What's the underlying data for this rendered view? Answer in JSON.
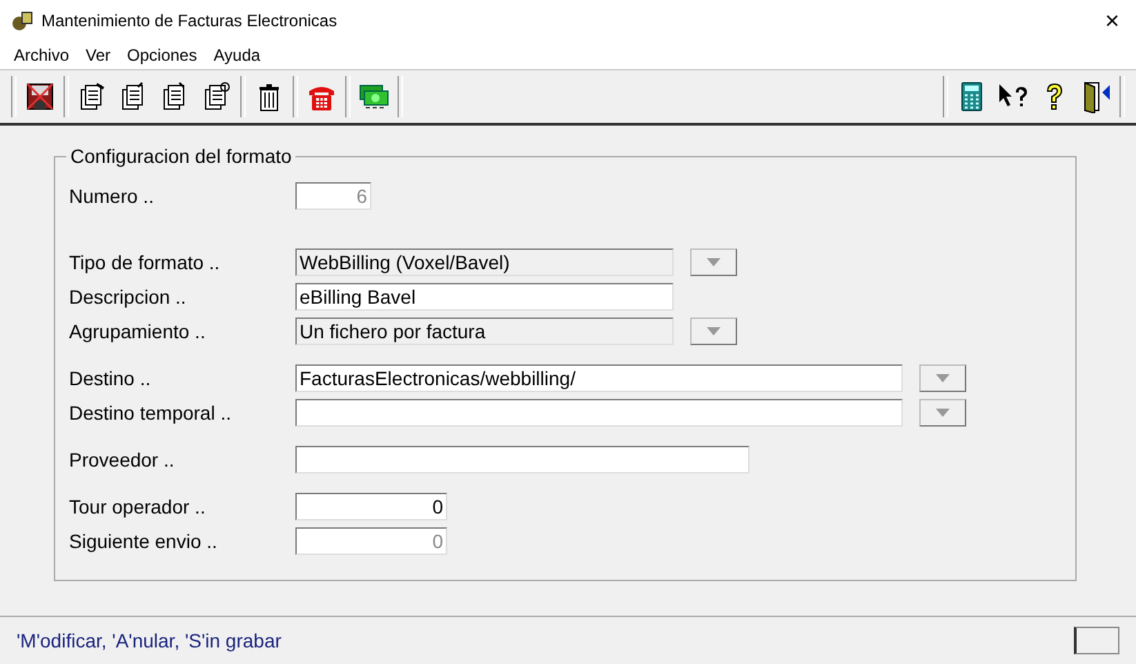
{
  "window": {
    "title": "Mantenimiento de Facturas Electronicas",
    "close": "×"
  },
  "menu": [
    "Archivo",
    "Ver",
    "Opciones",
    "Ayuda"
  ],
  "toolbar_left": [
    {
      "kind": "save"
    },
    {
      "kind": "doc-edit"
    },
    {
      "kind": "doc-up"
    },
    {
      "kind": "doc-down"
    },
    {
      "kind": "doc-refresh"
    },
    {
      "kind": "trash"
    },
    {
      "kind": "phone"
    },
    {
      "kind": "money"
    }
  ],
  "toolbar_right": [
    {
      "kind": "calculator"
    },
    {
      "kind": "pointer-help"
    },
    {
      "kind": "help"
    },
    {
      "kind": "exit"
    }
  ],
  "group": {
    "title": "Configuracion del formato",
    "sections": [
      [
        {
          "label": "Numero ..",
          "value": "6",
          "kind": "number",
          "disabled": true,
          "readonly": false
        }
      ],
      [
        {
          "label": "Tipo de formato ..",
          "value": "WebBilling (Voxel/Bavel)",
          "kind": "combo",
          "disabled": false,
          "readonly": true
        },
        {
          "label": "Descripcion ..",
          "value": "eBilling Bavel",
          "kind": "text",
          "disabled": false,
          "readonly": false
        },
        {
          "label": "Agrupamiento ..",
          "value": "Un fichero por factura",
          "kind": "combo",
          "disabled": false,
          "readonly": true
        }
      ],
      [
        {
          "label": "Destino ..",
          "value": "FacturasElectronicas/webbilling/",
          "kind": "combo",
          "disabled": false,
          "readonly": false
        },
        {
          "label": "Destino temporal ..",
          "kind": "combo",
          "readonly": false
        }
      ],
      [
        {
          "label": "Proveedor ..",
          "kind": "text",
          "readonly": false
        }
      ],
      [
        {
          "label": "Tour operador ..",
          "value": "0",
          "kind": "number",
          "disabled": false,
          "readonly": false
        },
        {
          "label": "Siguiente envio ..",
          "value": "0",
          "kind": "number",
          "disabled": true,
          "readonly": false
        }
      ]
    ]
  },
  "status_bar": {
    "text": "'M'odificar, 'A'nular, 'S'in grabar"
  }
}
